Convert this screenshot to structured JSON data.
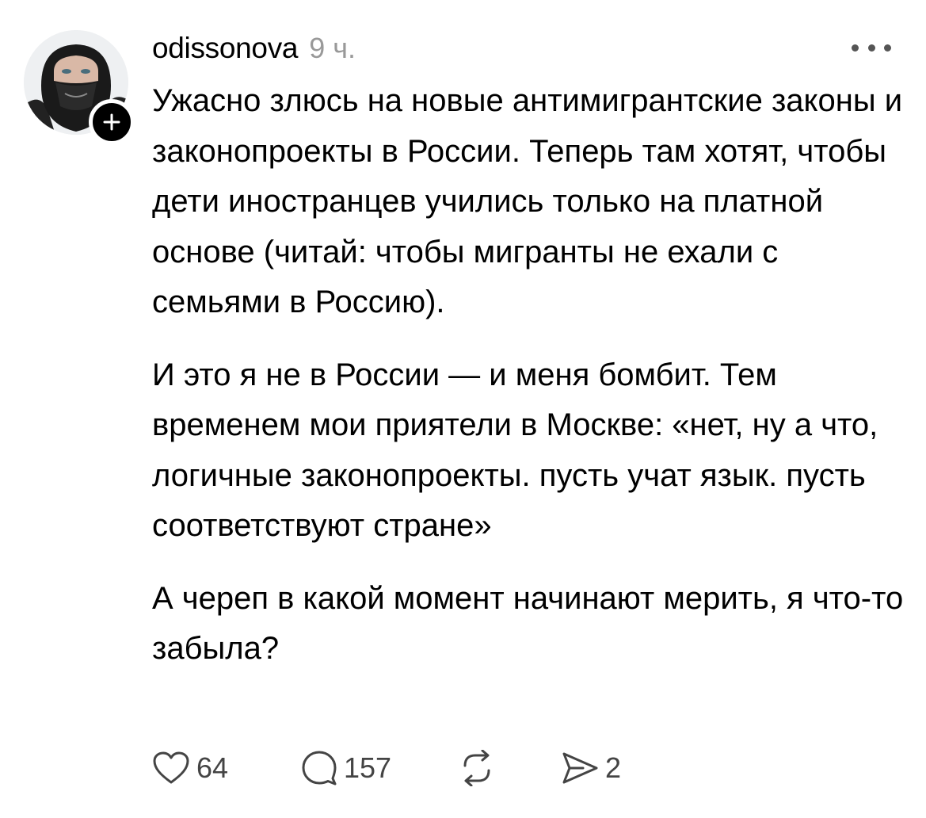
{
  "post": {
    "username": "odissonova",
    "time": "9 ч.",
    "paragraphs": [
      "Ужасно злюсь на новые антимигрантские законы и законопроекты в России. Теперь там хотят, чтобы дети иностранцев учились только на платной основе (читай: чтобы мигранты не ехали с семьями в Россию).",
      "И это я не в России — и меня бомбит. Тем временем мои приятели в Москве: «нет, ну а что, логичные законопроекты. пусть учат язык. пусть соответствуют стране»",
      "А череп в какой момент начинают мерить, я что-то забыла?"
    ]
  },
  "actions": {
    "likes": "64",
    "replies": "157",
    "shares": "2"
  },
  "icons": {
    "follow": "plus-icon",
    "more": "more-dots-icon",
    "like": "heart-icon",
    "reply": "speech-bubble-icon",
    "repost": "repost-icon",
    "share": "send-icon"
  }
}
